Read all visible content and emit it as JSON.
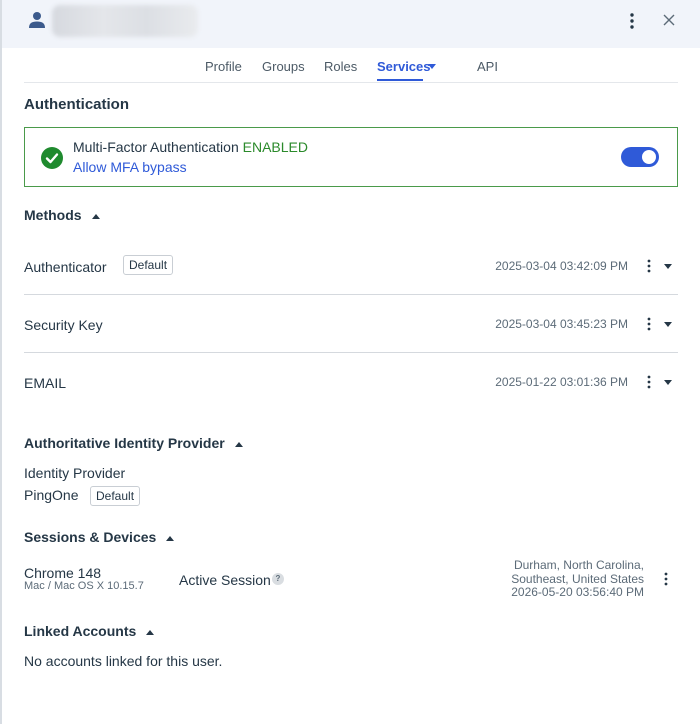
{
  "header": {
    "user_name": "",
    "icons": {
      "avatar": "person-icon",
      "menu": "kebab-menu-icon",
      "close": "close-icon"
    }
  },
  "tabs": [
    {
      "label": "Profile",
      "active": false
    },
    {
      "label": "Groups",
      "active": false
    },
    {
      "label": "Roles",
      "active": false
    },
    {
      "label": "Services",
      "active": true
    },
    {
      "label": "API",
      "active": false
    }
  ],
  "authentication": {
    "title": "Authentication",
    "mfa": {
      "label": "Multi-Factor Authentication",
      "status": "ENABLED",
      "bypass_link": "Allow MFA bypass",
      "toggle_on": true
    }
  },
  "methods": {
    "title": "Methods",
    "items": [
      {
        "name": "Authenticator",
        "badge": "Default",
        "date": "2025-03-04 03:42:09 PM"
      },
      {
        "name": "Security Key",
        "badge": "",
        "date": "2025-03-04 03:45:23 PM"
      },
      {
        "name": "EMAIL",
        "badge": "",
        "date": "2025-01-22 03:01:36 PM"
      }
    ]
  },
  "authoritative_idp": {
    "title": "Authoritative Identity Provider",
    "label": "Identity Provider",
    "value": "PingOne",
    "badge": "Default"
  },
  "sessions": {
    "title": "Sessions & Devices",
    "items": [
      {
        "browser": "Chrome 148",
        "os": "Mac / Mac OS X 10.15.7",
        "status": "Active Session",
        "help": "?",
        "location_line1": "Durham, North Carolina,",
        "location_line2": "Southeast, United States",
        "timestamp": "2026-05-20 03:56:40 PM"
      }
    ]
  },
  "linked_accounts": {
    "title": "Linked Accounts",
    "empty_text": "No accounts linked for this user."
  },
  "colors": {
    "accent": "#2f5ad8",
    "success": "#2b8a2b",
    "text": "#253746",
    "header_bg": "#f1f4fa"
  }
}
